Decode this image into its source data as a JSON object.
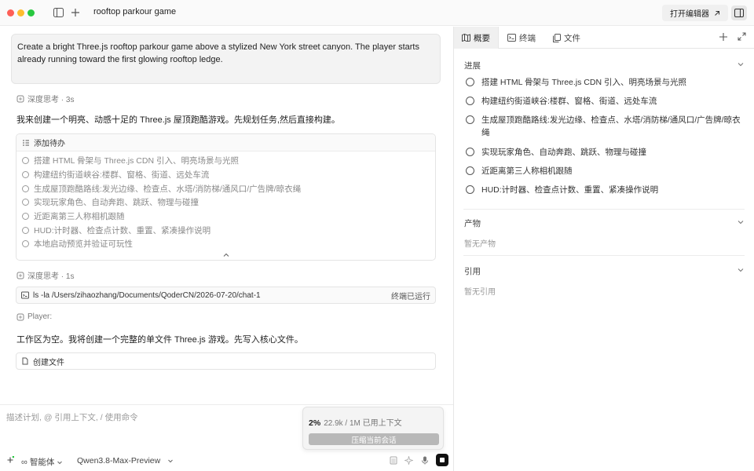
{
  "window": {
    "title": "rooftop parkour game",
    "open_editor_label": "打开编辑器"
  },
  "chat": {
    "user_message": "Create a bright Three.js rooftop parkour game above a stylized New York street canyon. The player starts already running toward the first glowing rooftop ledge.",
    "think_1": "深度思考 · 3s",
    "reply_1": "我来创建一个明亮、动感十足的 Three.js 屋顶跑酷游戏。先规划任务,然后直接构建。",
    "todo": {
      "header": "添加待办",
      "items": [
        "搭建 HTML 骨架与 Three.js CDN 引入、明亮场景与光照",
        "构建纽约街道峡谷:楼群、窗格、街道、远处车流",
        "生成屋顶跑酷路线:发光边缘、检查点、水塔/消防梯/通风口/广告牌/晾衣绳",
        "实现玩家角色、自动奔跑、跳跃、物理与碰撞",
        "近距离第三人称相机跟随",
        "HUD:计时器、检查点计数、重置、紧凑操作说明",
        "本地启动预览并验证可玩性"
      ]
    },
    "think_2": "深度思考 · 1s",
    "command": {
      "text": "ls -la /Users/zihaozhang/Documents/QoderCN/2026-07-20/chat-1",
      "status": "终端已运行"
    },
    "player_label": "Player:",
    "reply_2": "工作区为空。我将创建一个完整的单文件 Three.js 游戏。先写入核心文件。",
    "create_file_label": "创建文件"
  },
  "input": {
    "placeholder": "描述计划, @ 引用上下文, / 使用命令",
    "agent_label": "智能体",
    "model_label": "Qwen3.8-Max-Preview"
  },
  "context_popup": {
    "percent": "2%",
    "usage": "22.9k / 1M  已用上下文",
    "compress_label": "压缩当前会话"
  },
  "right_panel": {
    "tabs": [
      "概要",
      "终端",
      "文件"
    ],
    "progress_title": "进展",
    "progress_items": [
      "搭建 HTML 骨架与 Three.js CDN 引入、明亮场景与光照",
      "构建纽约街道峡谷:楼群、窗格、街道、远处车流",
      "生成屋顶跑酷路线:发光边缘、检查点、水塔/消防梯/通风口/广告牌/晾衣绳",
      "实现玩家角色、自动奔跑、跳跃、物理与碰撞",
      "近距离第三人称相机跟随",
      "HUD:计时器、检查点计数、重置、紧凑操作说明"
    ],
    "artifacts_title": "产物",
    "artifacts_empty": "暂无产物",
    "refs_title": "引用",
    "refs_empty": "暂无引用"
  }
}
